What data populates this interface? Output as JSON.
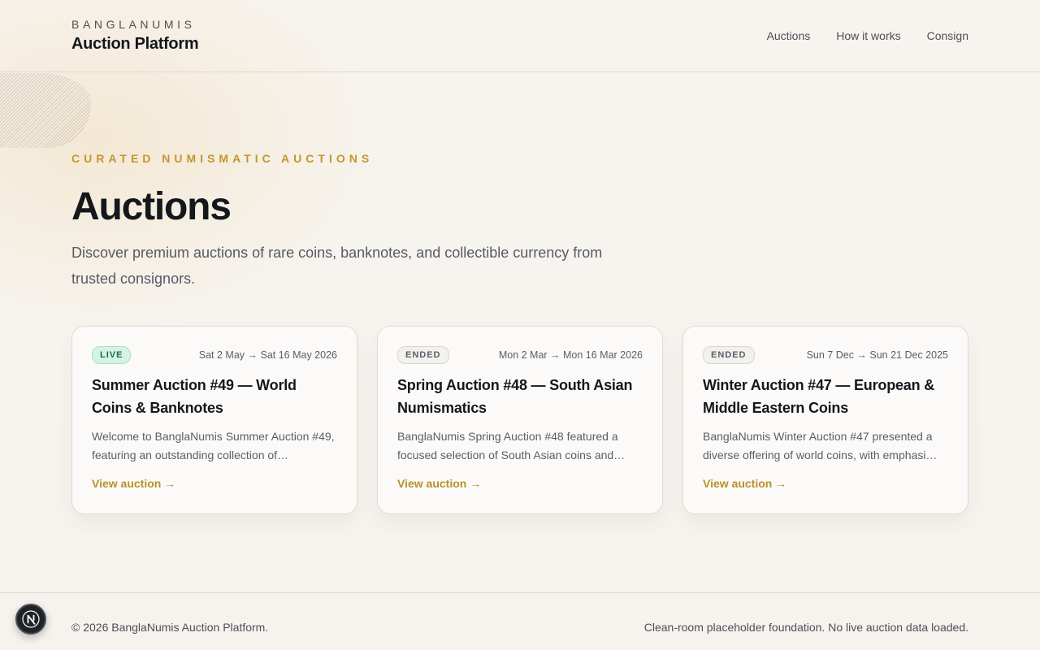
{
  "brand": {
    "kicker": "BANGLANUMIS",
    "title": "Auction Platform"
  },
  "nav": [
    "Auctions",
    "How it works",
    "Consign"
  ],
  "hero": {
    "eyebrow": "CURATED NUMISMATIC AUCTIONS",
    "title": "Auctions",
    "description": "Discover premium auctions of rare coins, banknotes, and collectible currency from trusted consignors."
  },
  "auctions": [
    {
      "status": "LIVE",
      "dates": "Sat 2 May → Sat 16 May 2026",
      "title": "Summer Auction #49 — World Coins & Banknotes",
      "description": "Welcome to BanglaNumis Summer Auction #49, featuring an outstanding collection of…",
      "link": "View auction →"
    },
    {
      "status": "ENDED",
      "dates": "Mon 2 Mar → Mon 16 Mar 2026",
      "title": "Spring Auction #48 — South Asian Numismatics",
      "description": "BanglaNumis Spring Auction #48 featured a focused selection of South Asian coins and…",
      "link": "View auction →"
    },
    {
      "status": "ENDED",
      "dates": "Sun 7 Dec → Sun 21 Dec 2025",
      "title": "Winter Auction #47 — European & Middle Eastern Coins",
      "description": "BanglaNumis Winter Auction #47 presented a diverse offering of world coins, with emphasi…",
      "link": "View auction →"
    }
  ],
  "footer": {
    "copyright": "© 2026 BanglaNumis Auction Platform.",
    "note": "Clean-room placeholder foundation. No live auction data loaded."
  },
  "dev_badge": {
    "icon": "nextjs-icon"
  },
  "colors": {
    "accent_gold": "#c4962e",
    "live_badge_bg": "#d5f3e4",
    "page_bg": "#f7f4ef"
  }
}
